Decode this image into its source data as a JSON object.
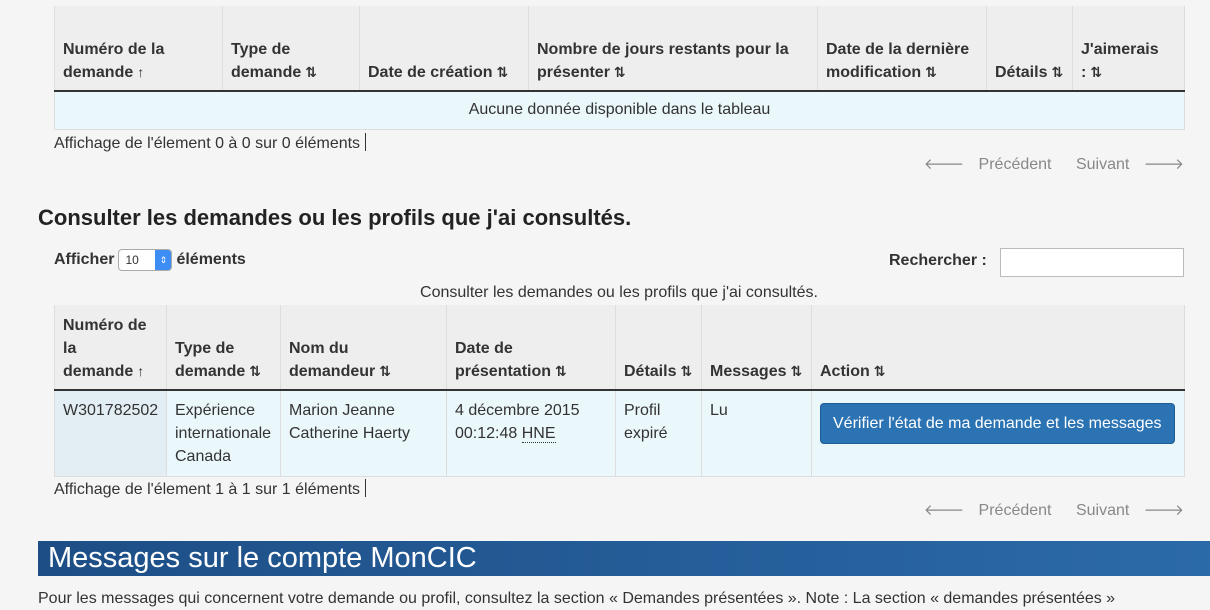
{
  "table1": {
    "headers": [
      {
        "label": "Numéro de la demande",
        "sort": "↑"
      },
      {
        "label": "Type de demande",
        "sort": "⇅"
      },
      {
        "label": "Date de création",
        "sort": "⇅"
      },
      {
        "label": "Nombre de jours restants pour la présenter",
        "sort": "⇅"
      },
      {
        "label": "Date de la dernière modification",
        "sort": "⇅"
      },
      {
        "label": "Détails",
        "sort": "⇅"
      },
      {
        "label": "J'aimerais :",
        "sort": "⇅"
      }
    ],
    "empty_message": "Aucune donnée disponible dans le tableau",
    "info": "Affichage de l'élement 0 à 0 sur 0 éléments",
    "prev": "Précédent",
    "next": "Suivant"
  },
  "section2": {
    "title": "Consulter les demandes ou les profils que j'ai consultés.",
    "show_label": "Afficher",
    "show_value": "10",
    "show_suffix": "éléments",
    "search_label": "Rechercher :",
    "search_value": "",
    "caption": "Consulter les demandes ou les profils que j'ai consultés."
  },
  "table2": {
    "headers": [
      {
        "label": "Numéro de la demande",
        "sort": "↑"
      },
      {
        "label": "Type de demande",
        "sort": "⇅"
      },
      {
        "label": "Nom du demandeur",
        "sort": "⇅"
      },
      {
        "label": "Date de présentation",
        "sort": "⇅"
      },
      {
        "label": "Détails",
        "sort": "⇅"
      },
      {
        "label": "Messages",
        "sort": "⇅"
      },
      {
        "label": "Action",
        "sort": "⇅"
      }
    ],
    "row": {
      "numero": "W301782502",
      "type": "Expérience internationale Canada",
      "nom": "Marion Jeanne Catherine Haerty",
      "date": "4 décembre 2015 00:12:48",
      "tz": "HNE",
      "details": "Profil expiré",
      "messages": "Lu",
      "action": "Vérifier l'état de ma demande et les messages"
    },
    "info": "Affichage de l'élement 1 à 1 sur 1 éléments",
    "prev": "Précédent",
    "next": "Suivant"
  },
  "messages": {
    "banner": "Messages sur le compte MonCIC",
    "note": "Pour les messages qui concernent votre demande ou profil, consultez la section « Demandes présentées ». Note : La section « demandes présentées »"
  }
}
